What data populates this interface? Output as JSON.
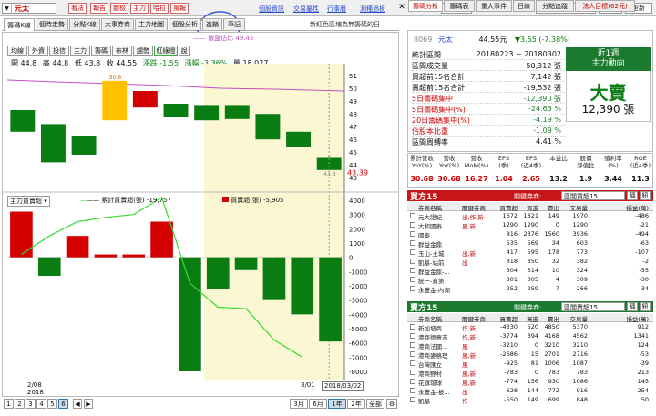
{
  "topbar": {
    "stock": "元太",
    "buttons": [
      "看法",
      "報告",
      "體檢",
      "主力",
      "哈拉",
      "風報"
    ],
    "links": [
      "個股資訊",
      "交易屬性",
      "行事曆",
      "測種過板"
    ],
    "days_label": "統計天數:",
    "days_value": "1",
    "date_label": "日期:",
    "date_value": "2018/3/2",
    "today_button": "今天",
    "refresh_button": "更新"
  },
  "left_tabs": [
    "籌碼K線",
    "個時走勢",
    "分點K線",
    "大事券商",
    "主力地圖",
    "個股分析",
    "進銷",
    "筆記"
  ],
  "left_tab_note": "新紅色區塊為無籌碼的日",
  "chart": {
    "tools": [
      "均線",
      "外資",
      "投信",
      "主力",
      "籌碼",
      "布林",
      "趨勢",
      "紅綠燈",
      "說"
    ],
    "ohlc": {
      "open": "開 44.8",
      "high": "高 44.8",
      "low": "低 43.8",
      "close": "收 44.55",
      "change": "漲跌 -1.55",
      "pct": "漲幅 -3.36%",
      "vol": "量 18,027"
    },
    "legend_top": "—— 散盤佔比 49.45",
    "price_axis": [
      "51",
      "50",
      "49",
      "48",
      "47",
      "46",
      "45",
      "44",
      "43"
    ],
    "last_price": "43.39",
    "tag_high": "50.6",
    "tag_low": "43.8",
    "candles": [
      {
        "open": 48.3,
        "close": 46.6,
        "high": 48.3,
        "low": 46.6
      },
      {
        "open": 47.2,
        "close": 44.2,
        "high": 47.2,
        "low": 44.2
      },
      {
        "open": 46.3,
        "close": 44.8,
        "high": 46.3,
        "low": 44.8
      },
      {
        "open": 50.6,
        "close": 47.5,
        "high": 50.6,
        "low": 47.5
      },
      {
        "open": 48.5,
        "close": 49.8,
        "high": 49.8,
        "low": 48.5
      },
      {
        "open": 48.8,
        "close": 47.8,
        "high": 48.8,
        "low": 47.8
      },
      {
        "open": 48.7,
        "close": 47.5,
        "high": 48.7,
        "low": 47.5
      },
      {
        "open": 48.7,
        "close": 47.6,
        "high": 48.7,
        "low": 47.6
      },
      {
        "open": 48.0,
        "close": 46.0,
        "high": 48.0,
        "low": 46.0
      },
      {
        "open": 46.6,
        "close": 45.4,
        "high": 46.6,
        "low": 45.4
      },
      {
        "open": 44.55,
        "close": 43.6,
        "high": 44.8,
        "low": 43.6
      }
    ],
    "sub_label": "主力買賣超",
    "sub_legend_cum": "—— 累計買賣超(張) -19,757",
    "sub_legend_net": "買賣超(張) -5,905",
    "sub_axis": [
      "4000",
      "3000",
      "2000",
      "1000",
      "0",
      "-1000",
      "-2000",
      "-3000",
      "-4000",
      "-5000",
      "-6000",
      "-7000",
      "-8000"
    ],
    "net_bars": [
      3200,
      -1300,
      1500,
      200,
      200,
      2500,
      -8000,
      -2200,
      -900,
      -3000,
      -4000,
      -5905
    ],
    "cum_line": [
      200,
      1500,
      2500,
      2800,
      3000,
      4200,
      -1800,
      -3500,
      -3600,
      -5800,
      -7000
    ],
    "date_left": "2/08",
    "year_left": "2018",
    "date_mid": "3/01",
    "date_box": "2018/03/02",
    "pages": [
      "1",
      "2",
      "3",
      "4",
      "5",
      "6"
    ],
    "periods": [
      "3月",
      "6月",
      "1年",
      "2年",
      "全部"
    ],
    "period_selected": "1年"
  },
  "right_tabs": [
    "籌碼分析",
    "籌碼表",
    "重大事件",
    "日線",
    "分點追蹤",
    "法人目標(62元)"
  ],
  "summary": {
    "code": "8069",
    "name": "元太",
    "price": "44.55元",
    "change": "▼3.55 (-7.38%)",
    "rows": [
      {
        "label": "統計區間",
        "value": "20180223 ~ 20180302",
        "color": "#111"
      },
      {
        "label": "區間成交量",
        "value": "50,312 張",
        "color": "#111"
      },
      {
        "label": "買超前15名合計",
        "value": "7,142 張",
        "color": "#111"
      },
      {
        "label": "賣超前15名合計",
        "value": "-19,532 張",
        "color": "#111"
      },
      {
        "label": "5日籌碼集中",
        "value": "-12,390 張",
        "color": "#1b7a2e"
      },
      {
        "label": "5日籌碼集中(%)",
        "value": "-24.63 %",
        "color": "#1b7a2e"
      },
      {
        "label": "20日籌碼集中(%)",
        "value": "-4.19 %",
        "color": "#1b7a2e"
      },
      {
        "label": "佔股本比重",
        "value": "-1.09 %",
        "color": "#1b7a2e"
      },
      {
        "label": "區間周轉率",
        "value": "4.41 %",
        "color": "#111"
      }
    ],
    "trend_title": "近1週",
    "trend_sub": "主力動向",
    "trend_big": "大賣",
    "trend_value": "12,390 張"
  },
  "fin": {
    "headers": [
      "累計營收\nYoY(%)",
      "營收\nYoY(%)",
      "營收\nMoM(%)",
      "EPS\n(季)",
      "EPS\n(近4季)",
      "本益比",
      "股價\n淨值比",
      "殖利率\n(%)",
      "ROE\n(近4季)"
    ],
    "values": [
      "30.68",
      "30.68",
      "16.27",
      "1.04",
      "2.65",
      "13.2",
      "1.9",
      "3.44",
      "11.3"
    ],
    "colors": [
      "#c00",
      "#c00",
      "#c00",
      "#c00",
      "#c00",
      "#111",
      "#111",
      "#111",
      "#111"
    ]
  },
  "buy": {
    "title": "買方15",
    "filter_label": "關鍵券商:",
    "filter_value": "區間買超15",
    "btn1": "稱",
    "btn2": "鈕",
    "headers": [
      "券商名稱",
      "關鍵券商",
      "買賣超",
      "買進",
      "賣出",
      "交易量",
      "損益(萬)"
    ],
    "rows": [
      [
        "元大證紀",
        "出,作,新",
        "1672",
        "1821",
        "149",
        "1970",
        "-486"
      ],
      [
        "大和國泰",
        "風,新",
        "1290",
        "1290",
        "0",
        "1290",
        "-21"
      ],
      [
        "國泰",
        "",
        "816",
        "2376",
        "1560",
        "3936",
        "-494"
      ],
      [
        "群益金鼎",
        "",
        "535",
        "569",
        "34",
        "603",
        "-63"
      ],
      [
        "玉山-土城",
        "出,新",
        "417",
        "595",
        "178",
        "773",
        "-107"
      ],
      [
        "凱基-站前",
        "出",
        "318",
        "350",
        "32",
        "382",
        "-2"
      ],
      [
        "群益金鼎-...",
        "",
        "304",
        "314",
        "10",
        "324",
        "-55"
      ],
      [
        "統一-寶第",
        "",
        "301",
        "305",
        "4",
        "309",
        "-30"
      ],
      [
        "永豐金-內湖",
        "",
        "252",
        "259",
        "7",
        "266",
        "-34"
      ]
    ]
  },
  "sell": {
    "title": "賣方15",
    "filter_label": "關鍵券商:",
    "filter_value": "區間賣超15",
    "btn1": "稱",
    "btn2": "鈕",
    "headers": [
      "券商名稱",
      "關鍵券商",
      "買賣超",
      "買進",
      "賣出",
      "交易量",
      "損益(萬)"
    ],
    "rows": [
      [
        "新加坡商...",
        "作,新",
        "-4330",
        "520",
        "4850",
        "5370",
        "912"
      ],
      [
        "港商德意志",
        "作,新",
        "-3774",
        "394",
        "4168",
        "4562",
        "1341"
      ],
      [
        "港商法國...",
        "風",
        "-3210",
        "0",
        "3210",
        "3210",
        "124"
      ],
      [
        "港商麥格理",
        "風,新",
        "-2686",
        "15",
        "2701",
        "2716",
        "-53"
      ],
      [
        "台灣匯立",
        "風",
        "-925",
        "81",
        "1006",
        "1087",
        "-39"
      ],
      [
        "港商野村",
        "風,新",
        "-783",
        "0",
        "783",
        "783",
        "213"
      ],
      [
        "花旗環球",
        "風,新",
        "-774",
        "156",
        "930",
        "1086",
        "145"
      ],
      [
        "永豐金-板...",
        "出",
        "-628",
        "144",
        "772",
        "916",
        "254"
      ],
      [
        "凱基",
        "作",
        "-550",
        "149",
        "699",
        "848",
        "50"
      ]
    ]
  },
  "colors": {
    "up": "#d40000",
    "down": "#0a7d12",
    "yellow": "#ffc000",
    "highlight": "#fbf7d2",
    "ma": "#c050c0",
    "cum": "#33dd33"
  }
}
